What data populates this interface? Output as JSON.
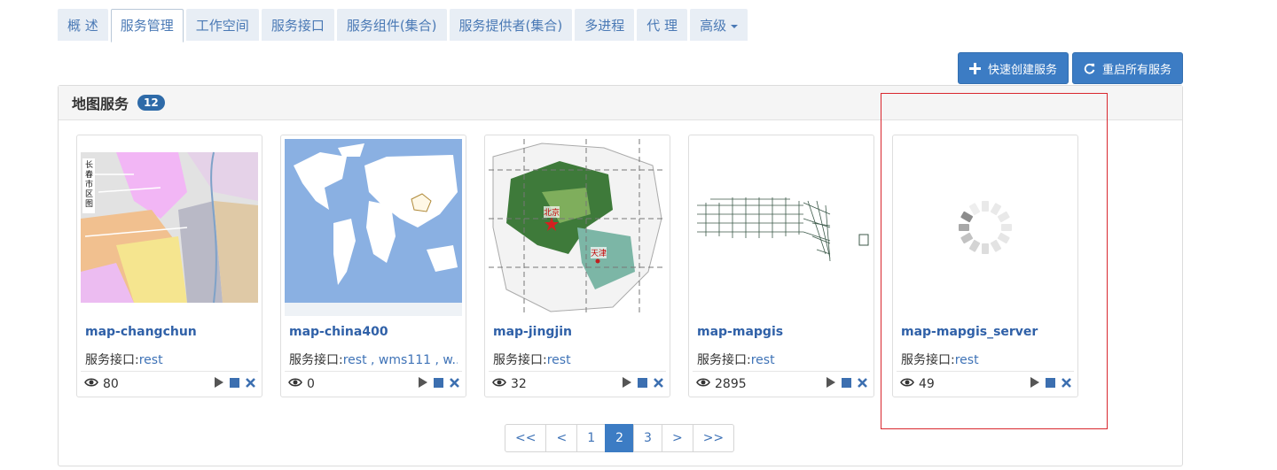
{
  "tabs": [
    {
      "label": "概 述"
    },
    {
      "label": "服务管理",
      "active": true
    },
    {
      "label": "工作空间"
    },
    {
      "label": "服务接口"
    },
    {
      "label": "服务组件(集合)"
    },
    {
      "label": "服务提供者(集合)"
    },
    {
      "label": "多进程"
    },
    {
      "label": "代 理"
    },
    {
      "label": "高级"
    }
  ],
  "actions": {
    "quick_create": "快速创建服务",
    "restart_all": "重启所有服务"
  },
  "panel": {
    "title": "地图服务",
    "count": "12"
  },
  "interface_label": "服务接口:",
  "cards": [
    {
      "name": "map-changchun",
      "interfaces": "rest",
      "views": "80",
      "thumb_text": "长春市区图"
    },
    {
      "name": "map-china400",
      "interfaces": "rest , wms111 , w...",
      "views": "0"
    },
    {
      "name": "map-jingjin",
      "interfaces": "rest",
      "views": "32",
      "city1": "北京",
      "city2": "天津"
    },
    {
      "name": "map-mapgis",
      "interfaces": "rest",
      "views": "2895"
    },
    {
      "name": "map-mapgis_server",
      "interfaces": "rest",
      "views": "49"
    }
  ],
  "pagination": {
    "first": "<<",
    "prev": "<",
    "pages": [
      "1",
      "2",
      "3"
    ],
    "current": "2",
    "next": ">",
    "last": ">>"
  },
  "colors": {
    "accent": "#3c7cc4",
    "tab_bg": "#e8eef5",
    "link": "#3061a8",
    "highlight": "#d9272e"
  },
  "icons": [
    "plus-icon",
    "refresh-icon",
    "eye-icon",
    "play-icon",
    "stop-icon",
    "delete-icon",
    "spinner-icon",
    "caret-down-icon"
  ]
}
